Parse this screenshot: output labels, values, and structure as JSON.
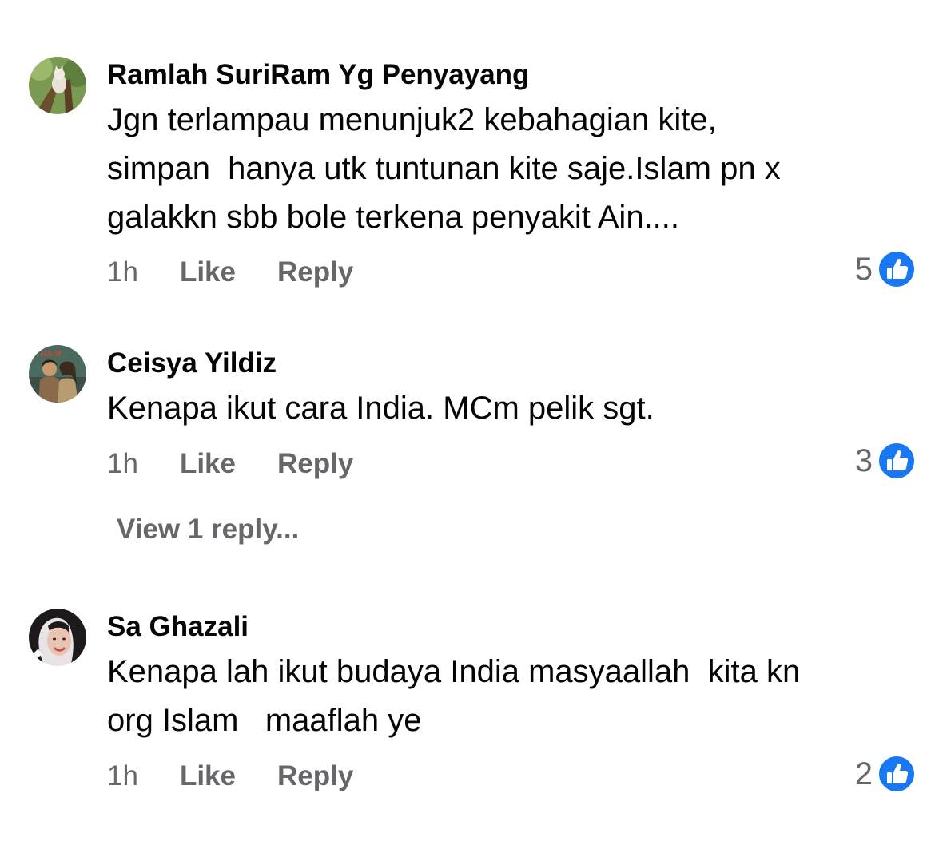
{
  "comments": [
    {
      "author": "Ramlah SuriRam Yg Penyayang",
      "text": "Jgn terlampau menunjuk2 kebahagian kite,\nsimpan  hanya utk tuntunan kite saje.Islam pn x\ngalakkn sbb bole terkena penyakit Ain....",
      "time": "1h",
      "like_label": "Like",
      "reply_label": "Reply",
      "reaction_count": "5",
      "reaction_icon": "thumbs-up-icon",
      "avatar": "avatar-cat-in-tree"
    },
    {
      "author": "Ceisya Yildiz",
      "text": "Kenapa ikut cara India. MCm pelik sgt.",
      "time": "1h",
      "like_label": "Like",
      "reply_label": "Reply",
      "reaction_count": "3",
      "reaction_icon": "thumbs-up-icon",
      "avatar": "avatar-couple-artwork",
      "view_replies": "View 1 reply..."
    },
    {
      "author": "Sa Ghazali",
      "text": "Kenapa lah ikut budaya India masyaallah  kita kn\norg Islam   maaflah ye",
      "time": "1h",
      "like_label": "Like",
      "reply_label": "Reply",
      "reaction_count": "2",
      "reaction_icon": "thumbs-up-icon",
      "avatar": "avatar-woman-portrait"
    }
  ],
  "colors": {
    "text_primary": "#050505",
    "text_secondary": "#65676b",
    "like_blue": "#1877f2"
  }
}
